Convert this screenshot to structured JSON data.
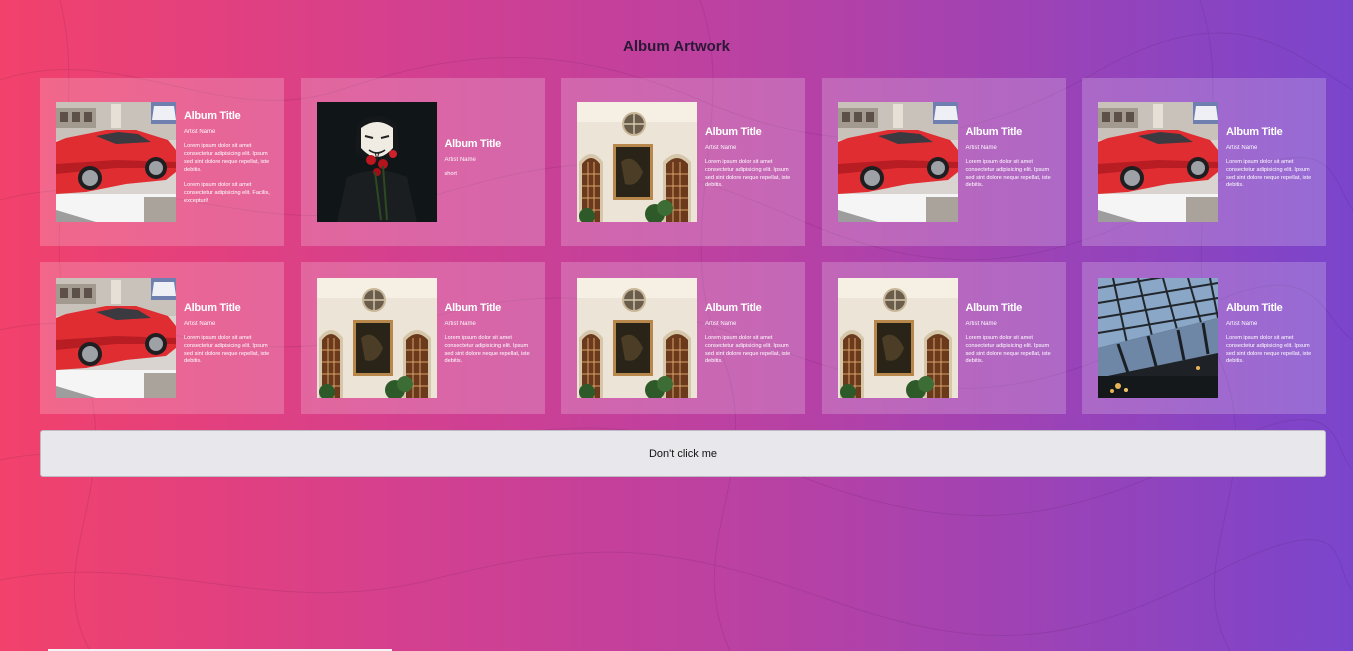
{
  "page": {
    "title": "Album Artwork"
  },
  "albums": [
    {
      "art": "car",
      "title": "Album Title",
      "artist": "Artist Name",
      "desc1": "Lorem ipsum dolor sit amet consectetur adipisicing elit. Ipsum sed sint dolore neque repellat, iste debitis.",
      "desc2": "Lorem ipsum dolor sit amet consectetur adipisicing elit. Facilis, excepturi!"
    },
    {
      "art": "mask",
      "title": "Album Title",
      "artist": "Artist Name",
      "desc1": "short",
      "desc2": ""
    },
    {
      "art": "church",
      "title": "Album Title",
      "artist": "Artist Name",
      "desc1": "Lorem ipsum dolor sit amet consectetur adipisicing elit. Ipsum sed sint dolore neque repellat, iste debitis.",
      "desc2": ""
    },
    {
      "art": "car",
      "title": "Album Title",
      "artist": "Artist Name",
      "desc1": "Lorem ipsum dolor sit amet consectetur adipisicing elit. Ipsum sed sint dolore neque repellat, iste debitis.",
      "desc2": ""
    },
    {
      "art": "car",
      "title": "Album Title",
      "artist": "Artist Name",
      "desc1": "Lorem ipsum dolor sit amet consectetur adipisicing elit. Ipsum sed sint dolore neque repellat, iste debitis.",
      "desc2": ""
    },
    {
      "art": "car",
      "title": "Album Title",
      "artist": "Artist Name",
      "desc1": "Lorem ipsum dolor sit amet consectetur adipisicing elit. Ipsum sed sint dolore neque repellat, iste debitis.",
      "desc2": ""
    },
    {
      "art": "church",
      "title": "Album Title",
      "artist": "Artist Name",
      "desc1": "Lorem ipsum dolor sit amet consectetur adipisicing elit. Ipsum sed sint dolore neque repellat, iste debitis.",
      "desc2": ""
    },
    {
      "art": "church",
      "title": "Album Title",
      "artist": "Artist Name",
      "desc1": "Lorem ipsum dolor sit amet consectetur adipisicing elit. Ipsum sed sint dolore neque repellat, iste debitis.",
      "desc2": ""
    },
    {
      "art": "church",
      "title": "Album Title",
      "artist": "Artist Name",
      "desc1": "Lorem ipsum dolor sit amet consectetur adipisicing elit. Ipsum sed sint dolore neque repellat, iste debitis.",
      "desc2": ""
    },
    {
      "art": "roof",
      "title": "Album Title",
      "artist": "Artist Name",
      "desc1": "Lorem ipsum dolor sit amet consectetur adipisicing elit. Ipsum sed sint dolore neque repellat, iste debitis.",
      "desc2": ""
    }
  ],
  "button": {
    "label": "Don't click me"
  },
  "colors": {
    "gradient_start": "#f2416b",
    "gradient_end": "#7a45cc",
    "card_bg": "rgba(255,255,255,0.20)"
  }
}
